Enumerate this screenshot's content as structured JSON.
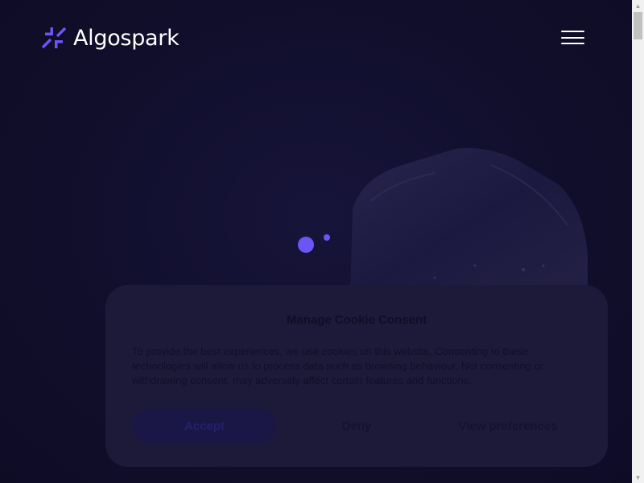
{
  "header": {
    "brand_name": "Algospark",
    "logo_icon": "spark-arrows-icon",
    "menu_icon": "hamburger-menu-icon"
  },
  "hero": {
    "loader_icon": "loading-dots-icon"
  },
  "consent": {
    "title": "Manage Cookie Consent",
    "body": "To provide the best experiences, we use cookies on this website. Consenting to these technologies will allow us to process data such as browsing behaviour. Not consenting or withdrawing consent, may adversely affect certain features and functions.",
    "accept_label": "Accept",
    "deny_label": "Deny",
    "preferences_label": "View preferences"
  },
  "colors": {
    "background": "#100e2a",
    "accent": "#6c55f5",
    "panel": "#1c1a38"
  }
}
